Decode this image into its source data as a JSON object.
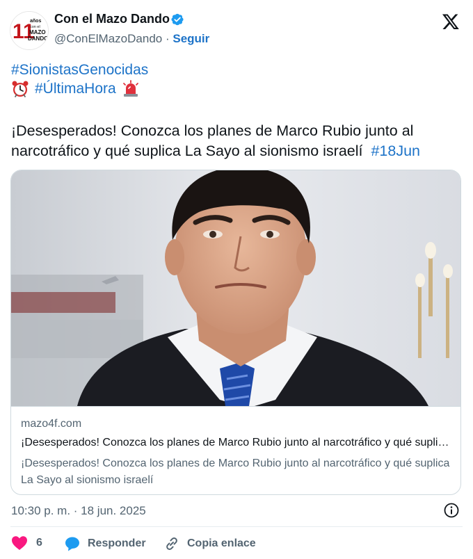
{
  "author": {
    "display_name": "Con el Mazo Dando",
    "handle": "@ConElMazoDando",
    "separator": "·",
    "follow_label": "Seguir",
    "avatar_text": [
      "11",
      "años",
      "con el",
      "MAZO",
      "DANDO"
    ]
  },
  "tweet": {
    "hashtag_line1": "#SionistasGenocidas",
    "hashtag_line2": "#ÚltimaHora",
    "text": "¡Desesperados! Conozca los planes de Marco Rubio junto al narcotráfico y qué suplica La Sayo al sionismo israelí",
    "trailing_hashtag": "#18Jun"
  },
  "link_card": {
    "domain": "mazo4f.com",
    "title": "¡Desesperados! Conozca los planes de Marco Rubio junto al narcotráfico y qué suplica La Sayo al sionismo israelí",
    "description": "¡Desesperados! Conozca los planes de Marco Rubio junto al narcotráfico y qué suplica La Sayo al sionismo israelí"
  },
  "meta": {
    "timestamp": "10:30 p. m. · 18 jun. 2025"
  },
  "actions": {
    "like_count": "6",
    "reply_label": "Responder",
    "copy_label": "Copia enlace"
  },
  "colors": {
    "link_blue": "#1d73c8",
    "verified_blue": "#1d9bf0",
    "like_pink": "#f91880",
    "text_primary": "#0f1419",
    "text_secondary": "#536471"
  },
  "icons": [
    "verified-badge-icon",
    "x-logo-icon",
    "alarm-clock-icon",
    "siren-icon",
    "info-icon",
    "heart-icon",
    "reply-bubble-icon",
    "link-icon"
  ]
}
